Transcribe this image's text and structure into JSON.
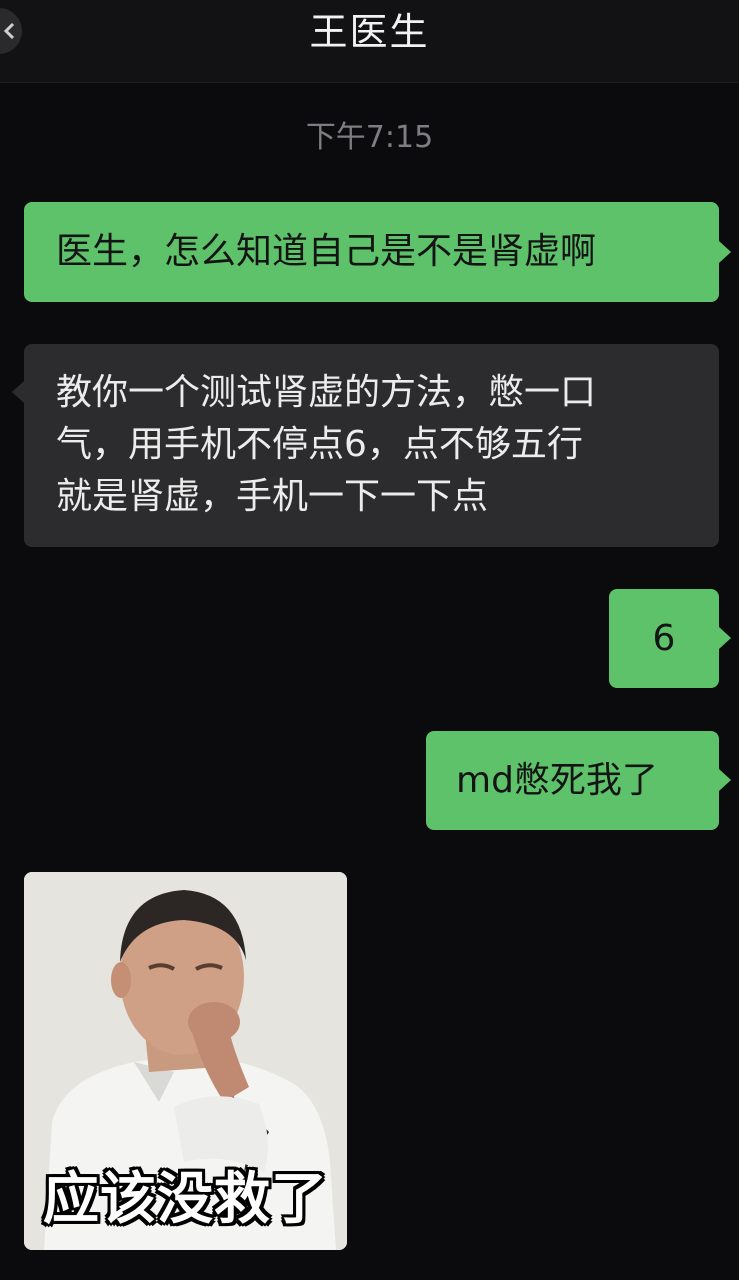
{
  "chat": {
    "title": "王医生",
    "timestamp": "下午7:15"
  },
  "messages": [
    {
      "side": "out",
      "text": "医生，怎么知道自己是不是肾虚啊"
    },
    {
      "side": "in",
      "lines": [
        "教你一个测试肾虚的方法，憋一口",
        "气，用手机不停点6，点不够五行",
        "就是肾虚，手机一下一下点"
      ]
    },
    {
      "side": "out",
      "text": "6"
    },
    {
      "side": "out",
      "text": "md憋死我了"
    }
  ],
  "sticker": {
    "caption": "应该没救了"
  },
  "colors": {
    "background": "#0b0b0d",
    "outgoing_bubble": "#5ec26b",
    "incoming_bubble": "#2c2c2e"
  }
}
